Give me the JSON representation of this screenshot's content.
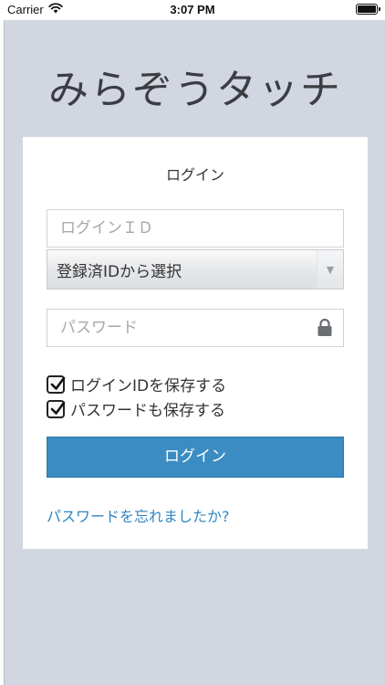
{
  "status_bar": {
    "carrier": "Carrier",
    "time": "3:07 PM",
    "icons": [
      "wifi-icon",
      "battery-icon"
    ]
  },
  "app": {
    "title": "みらぞうタッチ"
  },
  "login_form": {
    "heading": "ログイン",
    "login_id_placeholder": "ログインＩＤ",
    "saved_id_select_label": "登録済IDから選択",
    "password_placeholder": "パスワード",
    "save_id_label": "ログインIDを保存する",
    "save_id_checked": true,
    "save_password_label": "パスワードも保存する",
    "save_password_checked": true,
    "submit_label": "ログイン",
    "forgot_password_link": "パスワードを忘れましたか?"
  },
  "colors": {
    "background": "#d1d6e0",
    "card": "#ffffff",
    "primary_button": "#3a8cc2",
    "link": "#2e86c1",
    "title_text": "#3a3d42"
  }
}
